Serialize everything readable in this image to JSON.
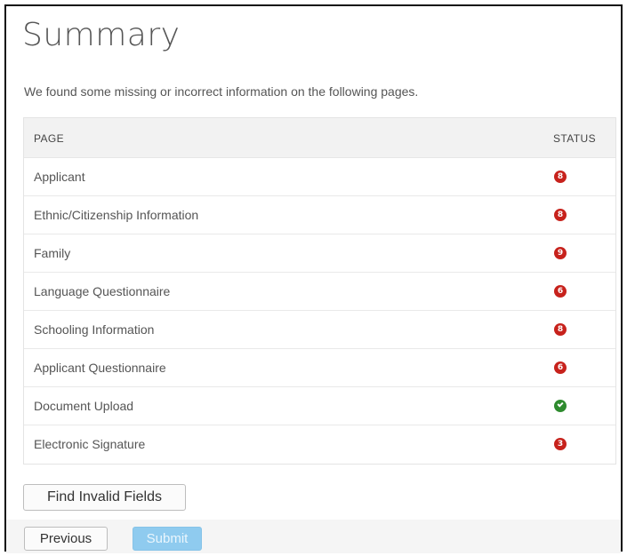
{
  "header": {
    "title": "Summary",
    "subtitle": "We found some missing or incorrect information on the following pages."
  },
  "table": {
    "columns": {
      "page": "PAGE",
      "status": "STATUS"
    },
    "rows": [
      {
        "page": "Applicant",
        "status": "error",
        "count": "8"
      },
      {
        "page": "Ethnic/Citizenship Information",
        "status": "error",
        "count": "8"
      },
      {
        "page": "Family",
        "status": "error",
        "count": "9"
      },
      {
        "page": "Language Questionnaire",
        "status": "error",
        "count": "6"
      },
      {
        "page": "Schooling Information",
        "status": "error",
        "count": "8"
      },
      {
        "page": "Applicant Questionnaire",
        "status": "error",
        "count": "6"
      },
      {
        "page": "Document Upload",
        "status": "ok",
        "count": ""
      },
      {
        "page": "Electronic Signature",
        "status": "error",
        "count": "3"
      }
    ]
  },
  "buttons": {
    "find_invalid": "Find Invalid Fields",
    "previous": "Previous",
    "submit": "Submit"
  },
  "colors": {
    "error_badge": "#c7221c",
    "ok_badge": "#2e8b2e",
    "submit_disabled": "#8fcbef"
  }
}
